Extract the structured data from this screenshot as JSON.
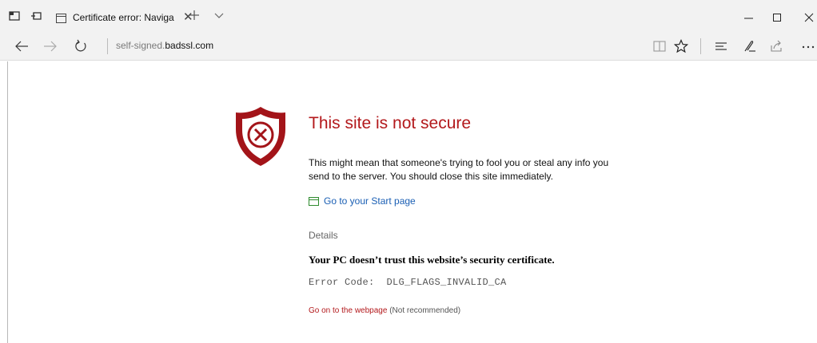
{
  "window": {
    "tab": {
      "title": "Certificate error: Naviga",
      "close_glyph": "✕"
    },
    "controls": [
      "minimize",
      "maximize",
      "close"
    ]
  },
  "address_bar": {
    "url_subdomain": "self-signed.",
    "url_domain": "badssl.com"
  },
  "page": {
    "heading": "This site is not secure",
    "message": "This might mean that someone's trying to fool you or steal any info you send to the server. You should close this site immediately.",
    "start_link": "Go to your Start page",
    "details_label": "Details",
    "trust_message": "Your PC doesn’t trust this website’s security certificate.",
    "error_code": "Error Code:  DLG_FLAGS_INVALID_CA",
    "go_on_link": "Go on to the webpage",
    "go_on_note": " (Not recommended)"
  },
  "colors": {
    "warning_red": "#b3191c",
    "link_blue": "#1a5fb4",
    "start_icon_green": "#2e8b2e",
    "chrome_bg": "#f2f2f2"
  },
  "icons": [
    "set-tabs-aside-icon",
    "show-tabs-aside-icon",
    "tab-page-icon",
    "new-tab-icon",
    "tab-list-chevron-icon",
    "minimize-icon",
    "maximize-icon",
    "close-window-icon",
    "back-icon",
    "forward-icon",
    "refresh-icon",
    "reading-view-icon",
    "favorite-star-icon",
    "hub-icon",
    "web-note-icon",
    "share-icon",
    "more-icon",
    "shield-x-icon",
    "start-page-icon"
  ]
}
